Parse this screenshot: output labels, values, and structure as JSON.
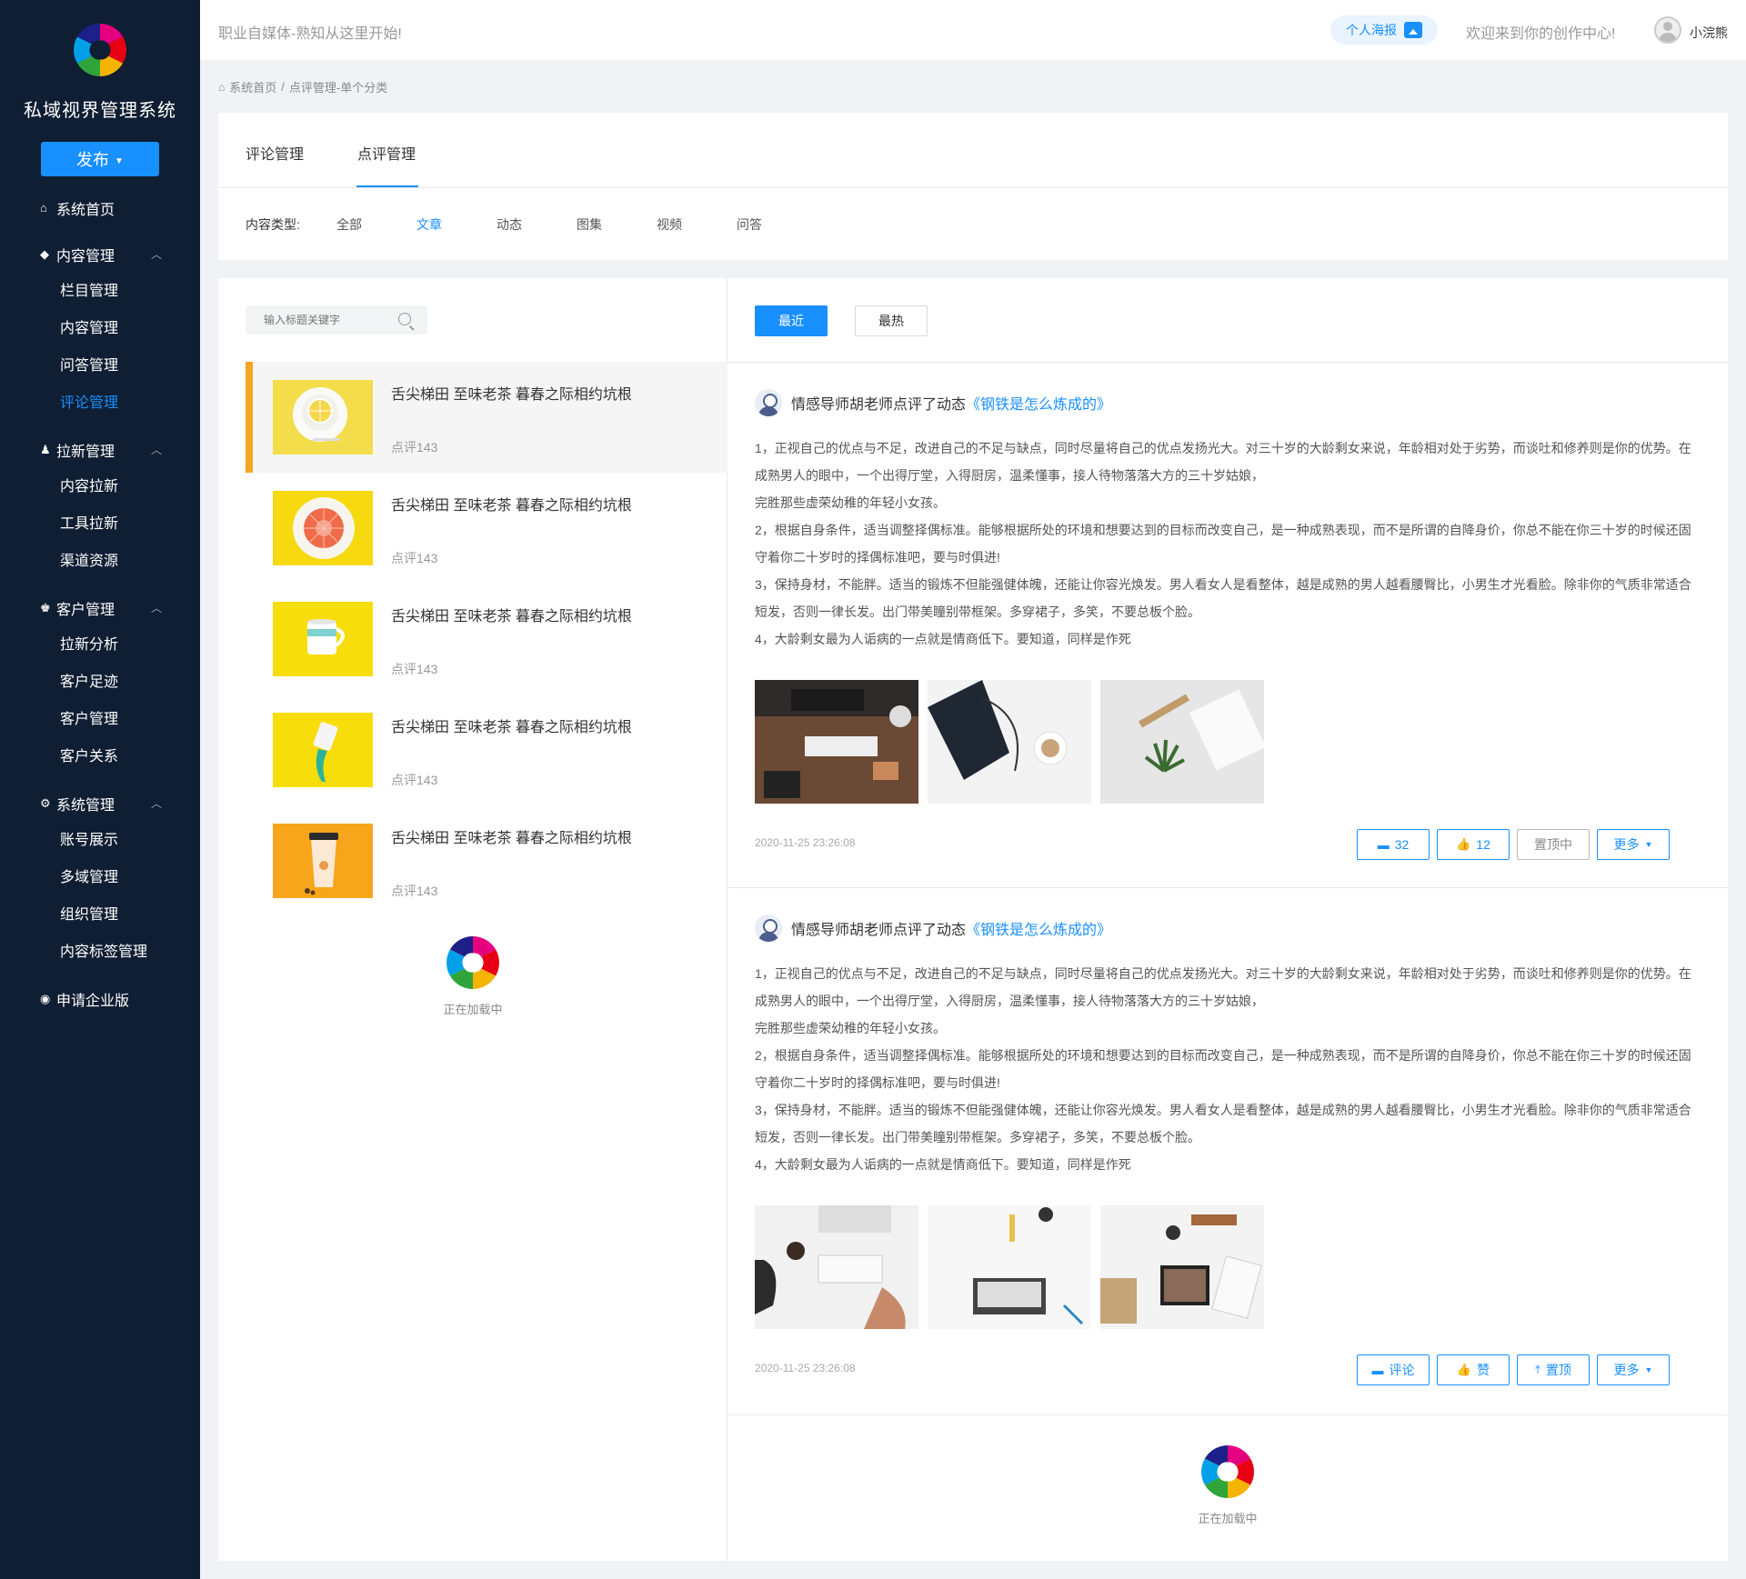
{
  "sidebar": {
    "brand": "私域视界管理系统",
    "publish_label": "发布",
    "home": "系统首页",
    "groups": [
      {
        "title": "内容管理",
        "items": [
          "栏目管理",
          "内容管理",
          "问答管理",
          "评论管理"
        ]
      },
      {
        "title": "拉新管理",
        "items": [
          "内容拉新",
          "工具拉新",
          "渠道资源"
        ]
      },
      {
        "title": "客户管理",
        "items": [
          "拉新分析",
          "客户足迹",
          "客户管理",
          "客户关系"
        ]
      },
      {
        "title": "系统管理",
        "items": [
          "账号展示",
          "多域管理",
          "组织管理",
          "内容标签管理"
        ]
      }
    ],
    "enterprise": "申请企业版"
  },
  "header": {
    "slogan": "职业自媒体-熟知从这里开始!",
    "poster_label": "个人海报",
    "welcome": "欢迎来到你的创作中心!",
    "username": "小浣熊"
  },
  "breadcrumb": {
    "home": "系统首页",
    "sep": "/",
    "current": "点评管理-单个分类"
  },
  "tabs": [
    "评论管理",
    "点评管理"
  ],
  "filter": {
    "label": "内容类型:",
    "options": [
      "全部",
      "文章",
      "动态",
      "图集",
      "视频",
      "问答"
    ],
    "selected": "文章"
  },
  "search": {
    "placeholder": "输入标题关键字"
  },
  "list_items": [
    {
      "title": "舌尖梯田 至味老茶  暮春之际相约坑根",
      "sub": "点评143"
    },
    {
      "title": "舌尖梯田 至味老茶  暮春之际相约坑根",
      "sub": "点评143"
    },
    {
      "title": "舌尖梯田 至味老茶  暮春之际相约坑根",
      "sub": "点评143"
    },
    {
      "title": "舌尖梯田 至味老茶  暮春之际相约坑根",
      "sub": "点评143"
    },
    {
      "title": "舌尖梯田 至味老茶  暮春之际相约坑根",
      "sub": "点评143"
    }
  ],
  "loading_text": "正在加载中",
  "sort_buttons": {
    "recent": "最近",
    "hot": "最热"
  },
  "reviews": [
    {
      "author_action": "情感导师胡老师点评了动态",
      "link": "《钢铁是怎么炼成的》",
      "paragraphs": [
        "1，正视自己的优点与不足，改进自己的不足与缺点，同时尽量将自己的优点发扬光大。对三十岁的大龄剩女来说，年龄相对处于劣势，而谈吐和修养则是你的优势。在成熟男人的眼中，一个出得厅堂，入得厨房，温柔懂事，接人待物落落大方的三十岁姑娘，",
        "完胜那些虚荣幼稚的年轻小女孩。",
        "2，根据自身条件，适当调整择偶标准。能够根据所处的环境和想要达到的目标而改变自己，是一种成熟表现，而不是所谓的自降身价，你总不能在你三十岁的时候还固守着你二十岁时的择偶标准吧，要与时俱进!",
        "3，保持身材，不能胖。适当的锻炼不但能强健体魄，还能让你容光焕发。男人看女人是看整体，越是成熟的男人越看腰臀比，小男生才光看脸。除非你的气质非常适合短发，否则一律长发。出门带美瞳别带框架。多穿裙子，多笑，不要总板个脸。",
        "4，大龄剩女最为人诟病的一点就是情商低下。要知道，同样是作死"
      ],
      "time": "2020-11-25 23:26:08",
      "actions": {
        "comment": "32",
        "like": "12",
        "top": "置顶中",
        "more": "更多"
      }
    },
    {
      "author_action": "情感导师胡老师点评了动态",
      "link": "《钢铁是怎么炼成的》",
      "paragraphs": [
        "1，正视自己的优点与不足，改进自己的不足与缺点，同时尽量将自己的优点发扬光大。对三十岁的大龄剩女来说，年龄相对处于劣势，而谈吐和修养则是你的优势。在成熟男人的眼中，一个出得厅堂，入得厨房，温柔懂事，接人待物落落大方的三十岁姑娘，",
        "完胜那些虚荣幼稚的年轻小女孩。",
        "2，根据自身条件，适当调整择偶标准。能够根据所处的环境和想要达到的目标而改变自己，是一种成熟表现，而不是所谓的自降身价，你总不能在你三十岁的时候还固守着你二十岁时的择偶标准吧，要与时俱进!",
        "3，保持身材，不能胖。适当的锻炼不但能强健体魄，还能让你容光焕发。男人看女人是看整体，越是成熟的男人越看腰臀比，小男生才光看脸。除非你的气质非常适合短发，否则一律长发。出门带美瞳别带框架。多穿裙子，多笑，不要总板个脸。",
        "4，大龄剩女最为人诟病的一点就是情商低下。要知道，同样是作死"
      ],
      "time": "2020-11-25 23:26:08",
      "actions": {
        "comment": "评论",
        "like": "赞",
        "top": "置顶",
        "more": "更多"
      }
    }
  ],
  "colors": {
    "sidebar_bg": "#0f1e33",
    "primary": "#1890ff",
    "active_marker": "#f5a623"
  }
}
